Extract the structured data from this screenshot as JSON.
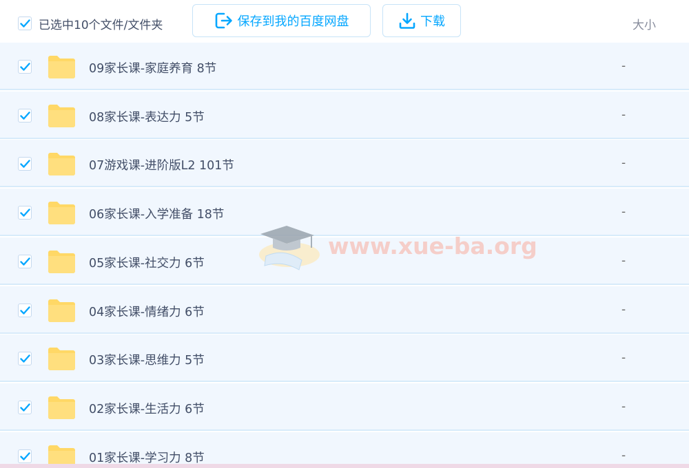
{
  "header": {
    "selection_label": "已选中10个文件/文件夹",
    "save_button_label": "保存到我的百度网盘",
    "download_button_label": "下载",
    "size_column_label": "大小"
  },
  "files": [
    {
      "name": "09家长课-家庭养育 8节",
      "size": "-",
      "checked": true
    },
    {
      "name": "08家长课-表达力 5节",
      "size": "-",
      "checked": true
    },
    {
      "name": "07游戏课-进阶版L2 101节",
      "size": "-",
      "checked": true
    },
    {
      "name": "06家长课-入学准备 18节",
      "size": "-",
      "checked": true
    },
    {
      "name": "05家长课-社交力 6节",
      "size": "-",
      "checked": true
    },
    {
      "name": "04家长课-情绪力 6节",
      "size": "-",
      "checked": true
    },
    {
      "name": "03家长课-思维力 5节",
      "size": "-",
      "checked": true
    },
    {
      "name": "02家长课-生活力 6节",
      "size": "-",
      "checked": true
    },
    {
      "name": "01家长课-学习力 8节",
      "size": "-",
      "checked": true
    }
  ],
  "watermark": {
    "text": "www.xue-ba.org"
  },
  "colors": {
    "accent": "#06a7ff",
    "row_bg": "#f1f7fe",
    "folder": "#ffd866",
    "text": "#424e67"
  },
  "icons": {
    "checkbox": "check-icon",
    "save": "save-to-disk-icon",
    "download": "download-icon",
    "folder": "folder-icon"
  }
}
